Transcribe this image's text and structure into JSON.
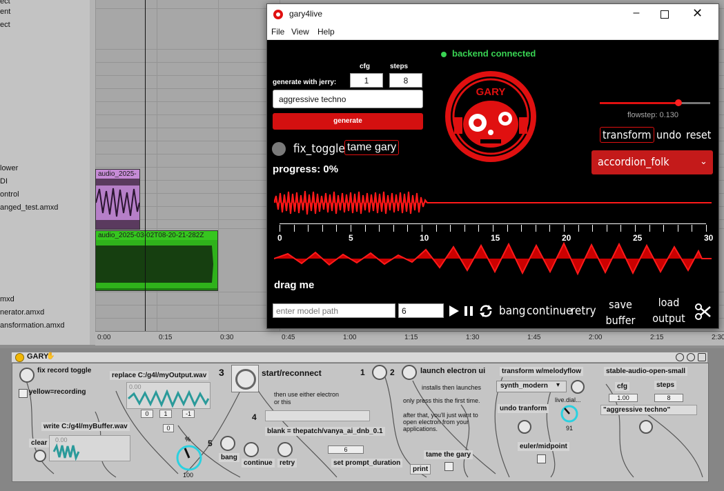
{
  "left_panel": {
    "tracks": [
      "ect",
      "ent",
      "ect",
      "lower",
      "DI",
      "ontrol",
      "anged_test.amxd",
      "",
      "mxd",
      "nerator.amxd",
      "ansformation.amxd"
    ]
  },
  "arrangement": {
    "clips": {
      "top_clip": "audio_2025-",
      "bottom_clip": "audio_2025-03-02T08-20-21-282Z"
    },
    "timeline": [
      "0:00",
      "0:15",
      "0:30",
      "0:45",
      "1:00",
      "1:15",
      "1:30",
      "1:45",
      "2:00",
      "2:15",
      "2:30"
    ]
  },
  "window": {
    "title": "gary4live",
    "menu": [
      "File",
      "View",
      "Help"
    ],
    "backend_status": "backend connected",
    "cfg_label": "cfg",
    "steps_label": "steps",
    "generate_with_label": "generate with jerry:",
    "cfg_value": "1",
    "steps_value": "8",
    "prompt_value": "aggressive techno",
    "generate_label": "generate",
    "fix_toggle_label": "fix_toggle",
    "tame_gary_label": "tame gary",
    "progress_label": "progress: 0%",
    "logo_text": "GARY",
    "flowstep_label": "flowstep: 0.130",
    "flowstep_value": 0.13,
    "transform_label": "transform",
    "undo_label": "undo",
    "reset_label": "reset",
    "preset_value": "accordion_folk",
    "axis_ticks": [
      "0",
      "5",
      "10",
      "15",
      "20",
      "25",
      "30"
    ],
    "drag_label": "drag me",
    "model_path_placeholder": "enter model path",
    "duration_value": "6",
    "bang_label": "bang",
    "continue_label": "continue",
    "retry_label": "retry",
    "save_buffer_label": "save buffer",
    "load_output_label": "load output",
    "icons": [
      "play-icon",
      "pause-icon",
      "refresh-icon",
      "scissors-icon"
    ],
    "colors": {
      "accent": "#e01010",
      "status": "#39d353"
    }
  },
  "device": {
    "title": "GARY",
    "fix_record_toggle": "fix record toggle",
    "yellow_recording": "yellow=recording",
    "replace_label": "replace C:/g4l/myOutput.wav",
    "write_label": "write C:/g4l/myBuffer.wav",
    "clear_label": "clear",
    "num_0": "0",
    "num_1": "1",
    "num_m1": "-1",
    "num_0b": "0",
    "num_00a": "0.00",
    "num_00b": "0.00",
    "dial_100": "100",
    "pct": "%",
    "n3": "3",
    "start_reconnect": "start/reconnect",
    "then_use": "then use either electron",
    "or_this": "or this",
    "n4": "4",
    "blank_label": "blank = thepatch/vanya_ai_dnb_0.1",
    "n5": "5",
    "bang": "bang",
    "continue": "continue",
    "retry": "retry",
    "num_6": "6",
    "set_prompt_duration": "set prompt_duration",
    "print": "print",
    "tame_the_gary": "tame the gary",
    "n1": "1",
    "n2": "2",
    "launch_electron": "launch electron ui",
    "installs": "installs then launches",
    "only_press": "only press this the first time.",
    "after_that": "after that, you'll just want to open electron from your applications.",
    "transform_melodyflow": "transform w/melodyflow",
    "synth_modern": "synth_modern",
    "live_dial": "live.dial...",
    "undo_tranform": "undo tranform",
    "dial_91": "91",
    "euler_midpoint": "euler/midpoint",
    "stable_audio": "stable-audio-open-small",
    "cfg": "cfg",
    "steps": "steps",
    "cfg_value": "1.00",
    "steps_value": "8",
    "prompt": "\"aggressive techno\""
  }
}
